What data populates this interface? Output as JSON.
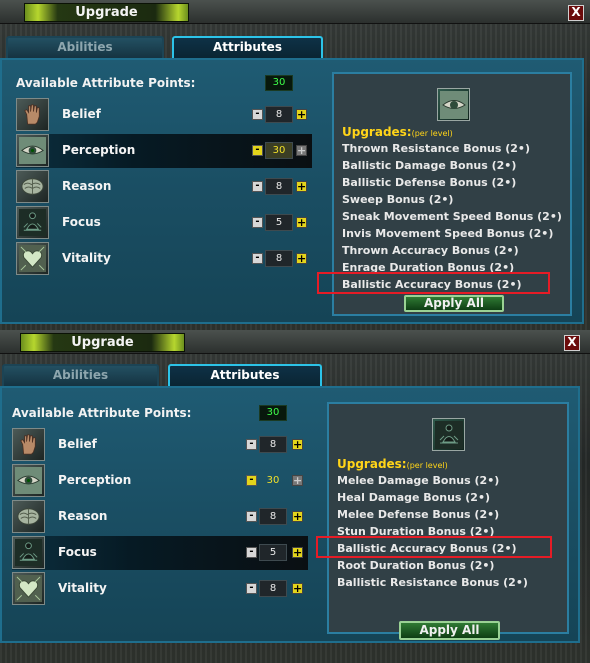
{
  "panel1": {
    "title": "Upgrade",
    "close_label": "X",
    "tabs": [
      {
        "label": "Abilities"
      },
      {
        "label": "Attributes"
      }
    ],
    "available_label": "Available Attribute Points:",
    "available_value": "30",
    "attributes": [
      {
        "label": "Belief",
        "value": "8",
        "icon": "hand-icon"
      },
      {
        "label": "Perception",
        "value": "30",
        "icon": "eye-icon"
      },
      {
        "label": "Reason",
        "value": "8",
        "icon": "brain-icon"
      },
      {
        "label": "Focus",
        "value": "5",
        "icon": "meditation-icon"
      },
      {
        "label": "Vitality",
        "value": "8",
        "icon": "heart-icon"
      }
    ],
    "minus_label": "-",
    "plus_label": "+",
    "upgrades_label": "Upgrades:",
    "per_level": "(per level)",
    "bonuses": [
      "Thrown Resistance Bonus (2•)",
      "Ballistic Damage Bonus (2•)",
      "Ballistic Defense Bonus (2•)",
      "Sweep Bonus (2•)",
      "Sneak Movement Speed Bonus (2•)",
      "Invis Movement Speed Bonus (2•)",
      "Thrown Accuracy Bonus (2•)",
      "Enrage Duration Bonus (2•)",
      "Ballistic Accuracy Bonus (2•)"
    ],
    "apply_label": "Apply All"
  },
  "panel2": {
    "title": "Upgrade",
    "close_label": "X",
    "tabs": [
      {
        "label": "Abilities"
      },
      {
        "label": "Attributes"
      }
    ],
    "available_label": "Available Attribute Points:",
    "available_value": "30",
    "attributes": [
      {
        "label": "Belief",
        "value": "8",
        "icon": "hand-icon"
      },
      {
        "label": "Perception",
        "value": "30",
        "icon": "eye-icon"
      },
      {
        "label": "Reason",
        "value": "8",
        "icon": "brain-icon"
      },
      {
        "label": "Focus",
        "value": "5",
        "icon": "meditation-icon"
      },
      {
        "label": "Vitality",
        "value": "8",
        "icon": "heart-icon"
      }
    ],
    "minus_label": "-",
    "plus_label": "+",
    "upgrades_label": "Upgrades:",
    "per_level": "(per level)",
    "bonuses": [
      "Melee Damage Bonus (2•)",
      "Heal Damage Bonus (2•)",
      "Melee Defense Bonus (2•)",
      "Stun Duration Bonus (2•)",
      "Ballistic Accuracy Bonus (2•)",
      "Root Duration Bonus (2•)",
      "Ballistic Resistance Bonus (2•)"
    ],
    "apply_label": "Apply All"
  },
  "colors": {
    "highlight": "#e61c26",
    "upgrades_text": "#ffd418",
    "points_text": "#3fff4a",
    "tab_active_border": "#2cc3e8"
  }
}
